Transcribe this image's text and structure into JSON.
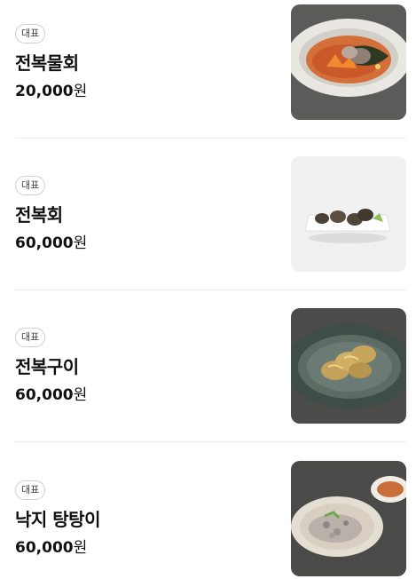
{
  "menu": {
    "items": [
      {
        "badge": "대표",
        "name": "전복물회",
        "price": "20,000",
        "currency": "원",
        "image": "abalone-cold-soup-photo"
      },
      {
        "badge": "대표",
        "name": "전복회",
        "price": "60,000",
        "currency": "원",
        "image": "abalone-sashimi-photo"
      },
      {
        "badge": "대표",
        "name": "전복구이",
        "price": "60,000",
        "currency": "원",
        "image": "grilled-abalone-photo"
      },
      {
        "badge": "대표",
        "name": "낙지 탕탕이",
        "price": "60,000",
        "currency": "원",
        "image": "chopped-octopus-photo"
      }
    ]
  }
}
